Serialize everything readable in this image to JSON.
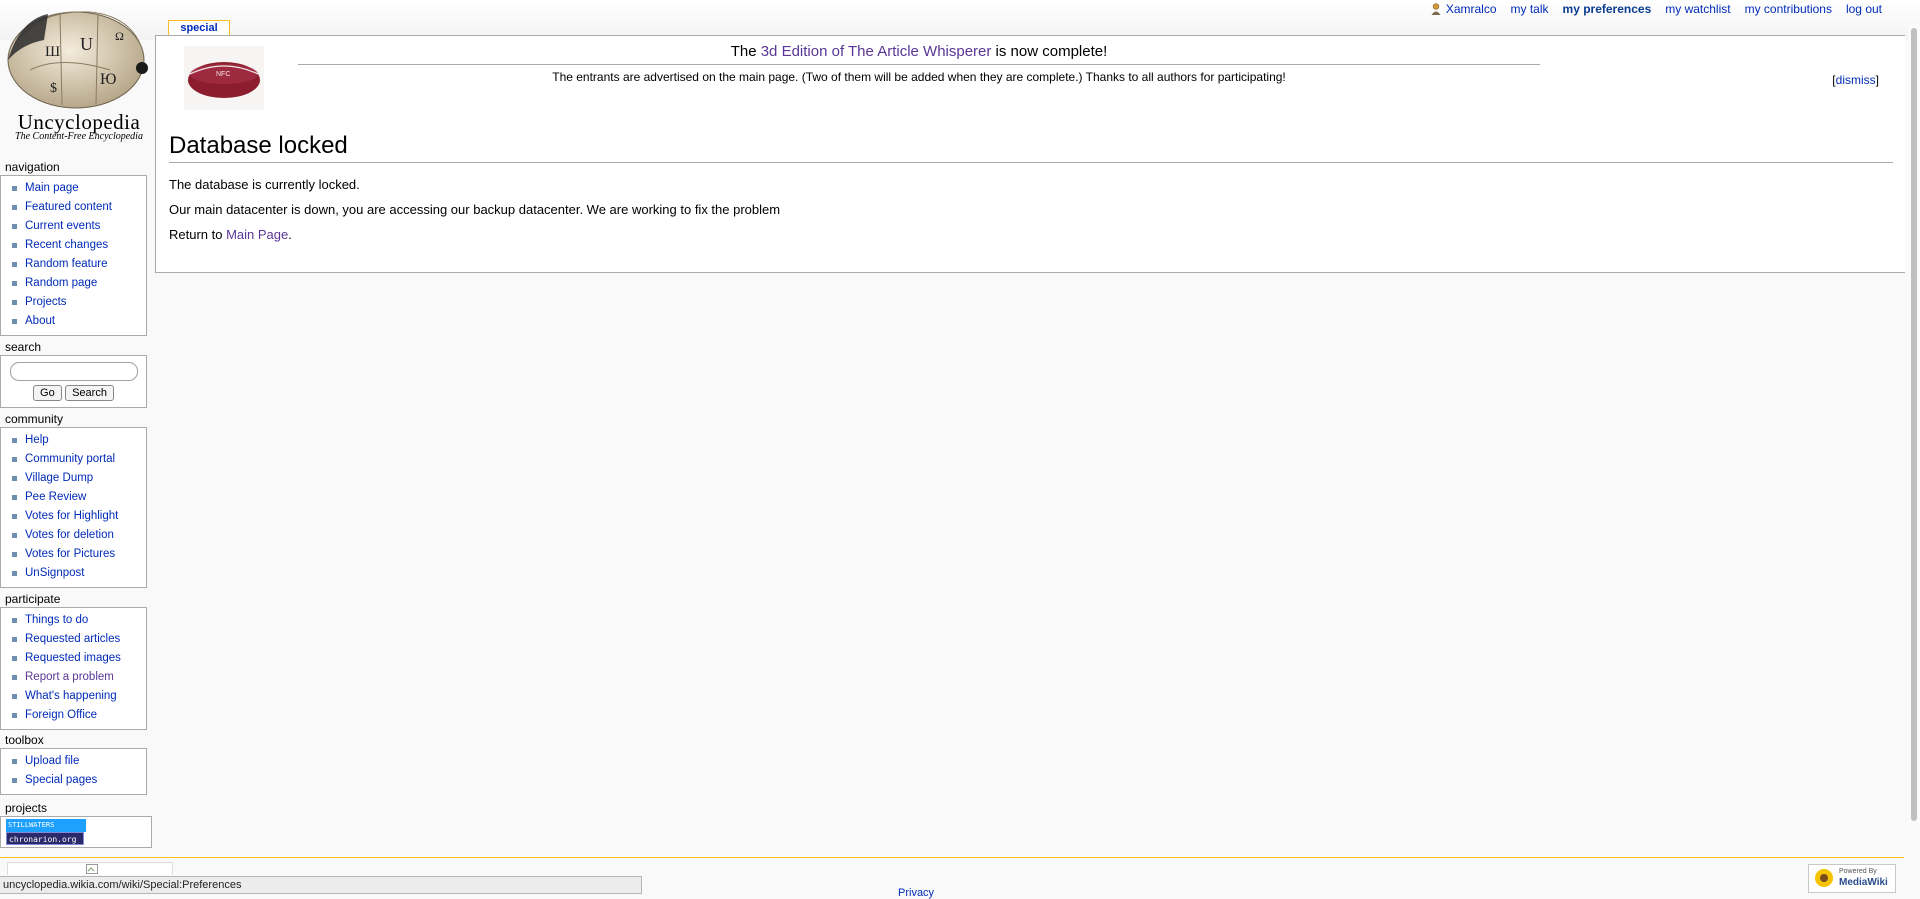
{
  "site": {
    "name": "Uncyclopedia",
    "tagline": "The Content-Free Encyclopedia"
  },
  "personal_tools": {
    "username": "Xamralco",
    "my_talk": "my talk",
    "my_preferences": "my preferences",
    "my_watchlist": "my watchlist",
    "my_contributions": "my contributions",
    "log_out": "log out"
  },
  "tab": {
    "label": "special"
  },
  "sitenotice": {
    "prefix": "The ",
    "link": "3d Edition of The Article Whisperer",
    "suffix": " is now complete!",
    "body": "The entrants are advertised on the main page. (Two of them will be added when they are complete.) Thanks to all authors for participating!",
    "dismiss": "dismiss",
    "image_text": "NFC"
  },
  "page": {
    "title": "Database locked",
    "para1": "The database is currently locked.",
    "para2": "Our main datacenter is down, you are accessing our backup datacenter. We are working to fix the problem",
    "return_prefix": "Return to ",
    "return_link": "Main Page",
    "return_suffix": "."
  },
  "sidebar": {
    "navigation": {
      "title": "navigation",
      "items": [
        "Main page",
        "Featured content",
        "Current events",
        "Recent changes",
        "Random feature",
        "Random page",
        "Projects",
        "About"
      ]
    },
    "search": {
      "title": "search",
      "placeholder": "",
      "go": "Go",
      "search": "Search"
    },
    "community": {
      "title": "community",
      "items": [
        "Help",
        "Community portal",
        "Village Dump",
        "Pee Review",
        "Votes for Highlight",
        "Votes for deletion",
        "Votes for Pictures",
        "UnSignpost"
      ]
    },
    "participate": {
      "title": "participate",
      "items": [
        "Things to do",
        "Requested articles",
        "Requested images",
        "Report a problem",
        "What's happening",
        "Foreign Office"
      ]
    },
    "toolbox": {
      "title": "toolbox",
      "items": [
        "Upload file",
        "Special pages"
      ]
    },
    "projects": {
      "title": "projects",
      "badge1": "STILLWATERS",
      "badge2": "chronarion.org"
    }
  },
  "footer": {
    "status_url": "uncyclopedia.wikia.com/wiki/Special:Preferences",
    "privacy": "Privacy",
    "powered_top": "Powered By",
    "powered_bottom": "MediaWiki"
  },
  "colors": {
    "link": "#002bb8",
    "visited": "#5a3696",
    "tab_border": "#fabd23",
    "bullet": "#6f8fb0"
  }
}
